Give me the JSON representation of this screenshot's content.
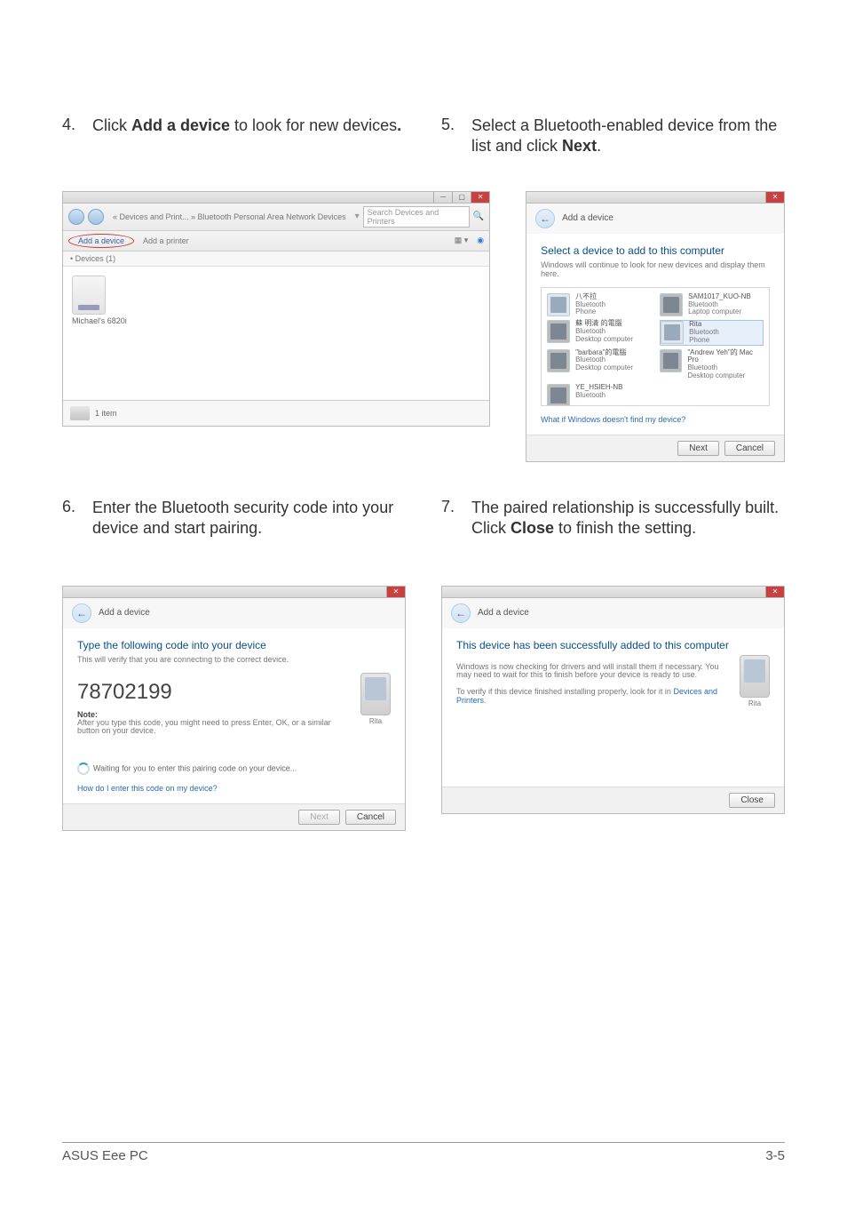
{
  "steps": {
    "s4": {
      "num": "4.",
      "prefix": "Click ",
      "bold": "Add a device",
      "suffix": " to look for new devices",
      "punct": "."
    },
    "s5": {
      "num": "5.",
      "prefix": "Select a Bluetooth-enabled device from the list and click ",
      "bold": "Next",
      "punct": "."
    },
    "s6": {
      "num": "6.",
      "text": "Enter the Bluetooth security code into your device and start pairing."
    },
    "s7": {
      "num": "7.",
      "prefix": "The paired relationship is successfully built. Click ",
      "bold": "Close",
      "suffix": " to finish the setting."
    }
  },
  "fig1": {
    "breadcrumb": "« Devices and Print... » Bluetooth Personal Area Network Devices",
    "search_placeholder": "Search Devices and Printers",
    "add_device": "Add a device",
    "add_printer": "Add a printer",
    "section": "• Devices (1)",
    "device_label": "Michael's 6820i",
    "status": "1 item"
  },
  "fig2": {
    "window_title": "Add a device",
    "heading": "Select a device to add to this computer",
    "subheading": "Windows will continue to look for new devices and display them here.",
    "devices": [
      {
        "name": "八不拉",
        "type": "Bluetooth",
        "kind": "Phone",
        "thumb": "phone"
      },
      {
        "name": "SAM1017_KUO-NB",
        "type": "Bluetooth",
        "kind": "Laptop computer",
        "thumb": "pc"
      },
      {
        "name": "蘇 明清 的電腦",
        "type": "Bluetooth",
        "kind": "Desktop computer",
        "thumb": "pc"
      },
      {
        "name": "Rita",
        "type": "Bluetooth",
        "kind": "Phone",
        "thumb": "phone",
        "selected": true
      },
      {
        "name": "\"barbara\"的電腦",
        "type": "Bluetooth",
        "kind": "Desktop computer",
        "thumb": "pc"
      },
      {
        "name": "\"Andrew Yeh\"的 Mac Pro",
        "type": "Bluetooth",
        "kind": "Desktop computer",
        "thumb": "pc"
      },
      {
        "name": "YE_HSIEH-NB",
        "type": "Bluetooth",
        "kind": "",
        "thumb": "pc"
      }
    ],
    "link": "What if Windows doesn't find my device?",
    "next": "Next",
    "cancel": "Cancel"
  },
  "fig3": {
    "window_title": "Add a device",
    "heading": "Type the following code into your device",
    "subheading": "This will verify that you are connecting to the correct device.",
    "code": "78702199",
    "note_label": "Note:",
    "note_text": "After you type this code, you might need to press Enter, OK, or a similar button on your device.",
    "phone_caption": "Rita",
    "waiting": "Waiting for you to enter this pairing code on your device...",
    "link": "How do I enter this code on my device?",
    "next": "Next",
    "cancel": "Cancel"
  },
  "fig4": {
    "window_title": "Add a device",
    "heading": "This device has been successfully added to this computer",
    "para1": "Windows is now checking for drivers and will install them if necessary. You may need to wait for this to finish before your device is ready to use.",
    "para2_prefix": "To verify if this device finished installing properly, look for it in ",
    "para2_link": "Devices and Printers",
    "phone_caption": "Rita",
    "close": "Close"
  },
  "footer": {
    "left": "ASUS Eee PC",
    "right": "3-5"
  }
}
